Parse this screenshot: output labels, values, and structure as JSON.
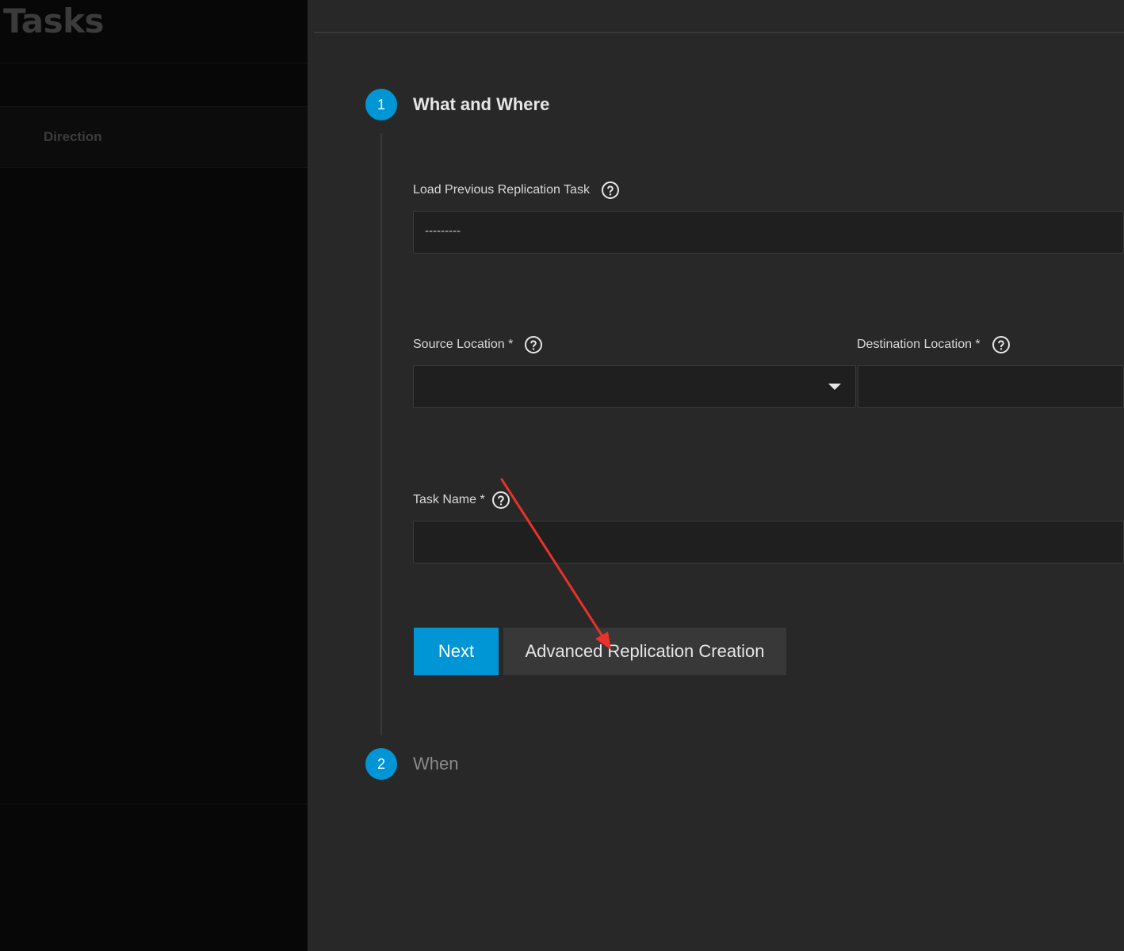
{
  "background": {
    "title": "Tasks",
    "column_header": "Direction"
  },
  "wizard": {
    "steps": [
      {
        "number": "1",
        "title": "What and Where"
      },
      {
        "number": "2",
        "title": "When"
      }
    ],
    "fields": {
      "load_previous": {
        "label": "Load Previous Replication Task",
        "value": "---------",
        "help_icon": "question-circle-icon"
      },
      "source_location": {
        "label": "Source Location *",
        "value": "",
        "help_icon": "question-circle-icon"
      },
      "destination_location": {
        "label": "Destination Location *",
        "value": "",
        "help_icon": "question-circle-icon"
      },
      "task_name": {
        "label": "Task Name *",
        "value": "",
        "help_icon": "question-circle-icon"
      }
    },
    "buttons": {
      "next": "Next",
      "advanced": "Advanced Replication Creation"
    }
  },
  "colors": {
    "accent": "#0095d5",
    "annotation_arrow": "#e8322b"
  }
}
